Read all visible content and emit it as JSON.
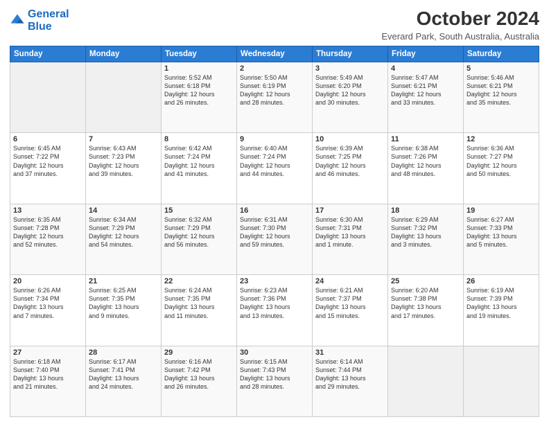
{
  "logo": {
    "line1": "General",
    "line2": "Blue"
  },
  "title": "October 2024",
  "location": "Everard Park, South Australia, Australia",
  "days_of_week": [
    "Sunday",
    "Monday",
    "Tuesday",
    "Wednesday",
    "Thursday",
    "Friday",
    "Saturday"
  ],
  "weeks": [
    [
      {
        "day": "",
        "content": ""
      },
      {
        "day": "",
        "content": ""
      },
      {
        "day": "1",
        "content": "Sunrise: 5:52 AM\nSunset: 6:18 PM\nDaylight: 12 hours\nand 26 minutes."
      },
      {
        "day": "2",
        "content": "Sunrise: 5:50 AM\nSunset: 6:19 PM\nDaylight: 12 hours\nand 28 minutes."
      },
      {
        "day": "3",
        "content": "Sunrise: 5:49 AM\nSunset: 6:20 PM\nDaylight: 12 hours\nand 30 minutes."
      },
      {
        "day": "4",
        "content": "Sunrise: 5:47 AM\nSunset: 6:21 PM\nDaylight: 12 hours\nand 33 minutes."
      },
      {
        "day": "5",
        "content": "Sunrise: 5:46 AM\nSunset: 6:21 PM\nDaylight: 12 hours\nand 35 minutes."
      }
    ],
    [
      {
        "day": "6",
        "content": "Sunrise: 6:45 AM\nSunset: 7:22 PM\nDaylight: 12 hours\nand 37 minutes."
      },
      {
        "day": "7",
        "content": "Sunrise: 6:43 AM\nSunset: 7:23 PM\nDaylight: 12 hours\nand 39 minutes."
      },
      {
        "day": "8",
        "content": "Sunrise: 6:42 AM\nSunset: 7:24 PM\nDaylight: 12 hours\nand 41 minutes."
      },
      {
        "day": "9",
        "content": "Sunrise: 6:40 AM\nSunset: 7:24 PM\nDaylight: 12 hours\nand 44 minutes."
      },
      {
        "day": "10",
        "content": "Sunrise: 6:39 AM\nSunset: 7:25 PM\nDaylight: 12 hours\nand 46 minutes."
      },
      {
        "day": "11",
        "content": "Sunrise: 6:38 AM\nSunset: 7:26 PM\nDaylight: 12 hours\nand 48 minutes."
      },
      {
        "day": "12",
        "content": "Sunrise: 6:36 AM\nSunset: 7:27 PM\nDaylight: 12 hours\nand 50 minutes."
      }
    ],
    [
      {
        "day": "13",
        "content": "Sunrise: 6:35 AM\nSunset: 7:28 PM\nDaylight: 12 hours\nand 52 minutes."
      },
      {
        "day": "14",
        "content": "Sunrise: 6:34 AM\nSunset: 7:29 PM\nDaylight: 12 hours\nand 54 minutes."
      },
      {
        "day": "15",
        "content": "Sunrise: 6:32 AM\nSunset: 7:29 PM\nDaylight: 12 hours\nand 56 minutes."
      },
      {
        "day": "16",
        "content": "Sunrise: 6:31 AM\nSunset: 7:30 PM\nDaylight: 12 hours\nand 59 minutes."
      },
      {
        "day": "17",
        "content": "Sunrise: 6:30 AM\nSunset: 7:31 PM\nDaylight: 13 hours\nand 1 minute."
      },
      {
        "day": "18",
        "content": "Sunrise: 6:29 AM\nSunset: 7:32 PM\nDaylight: 13 hours\nand 3 minutes."
      },
      {
        "day": "19",
        "content": "Sunrise: 6:27 AM\nSunset: 7:33 PM\nDaylight: 13 hours\nand 5 minutes."
      }
    ],
    [
      {
        "day": "20",
        "content": "Sunrise: 6:26 AM\nSunset: 7:34 PM\nDaylight: 13 hours\nand 7 minutes."
      },
      {
        "day": "21",
        "content": "Sunrise: 6:25 AM\nSunset: 7:35 PM\nDaylight: 13 hours\nand 9 minutes."
      },
      {
        "day": "22",
        "content": "Sunrise: 6:24 AM\nSunset: 7:35 PM\nDaylight: 13 hours\nand 11 minutes."
      },
      {
        "day": "23",
        "content": "Sunrise: 6:23 AM\nSunset: 7:36 PM\nDaylight: 13 hours\nand 13 minutes."
      },
      {
        "day": "24",
        "content": "Sunrise: 6:21 AM\nSunset: 7:37 PM\nDaylight: 13 hours\nand 15 minutes."
      },
      {
        "day": "25",
        "content": "Sunrise: 6:20 AM\nSunset: 7:38 PM\nDaylight: 13 hours\nand 17 minutes."
      },
      {
        "day": "26",
        "content": "Sunrise: 6:19 AM\nSunset: 7:39 PM\nDaylight: 13 hours\nand 19 minutes."
      }
    ],
    [
      {
        "day": "27",
        "content": "Sunrise: 6:18 AM\nSunset: 7:40 PM\nDaylight: 13 hours\nand 21 minutes."
      },
      {
        "day": "28",
        "content": "Sunrise: 6:17 AM\nSunset: 7:41 PM\nDaylight: 13 hours\nand 24 minutes."
      },
      {
        "day": "29",
        "content": "Sunrise: 6:16 AM\nSunset: 7:42 PM\nDaylight: 13 hours\nand 26 minutes."
      },
      {
        "day": "30",
        "content": "Sunrise: 6:15 AM\nSunset: 7:43 PM\nDaylight: 13 hours\nand 28 minutes."
      },
      {
        "day": "31",
        "content": "Sunrise: 6:14 AM\nSunset: 7:44 PM\nDaylight: 13 hours\nand 29 minutes."
      },
      {
        "day": "",
        "content": ""
      },
      {
        "day": "",
        "content": ""
      }
    ]
  ]
}
